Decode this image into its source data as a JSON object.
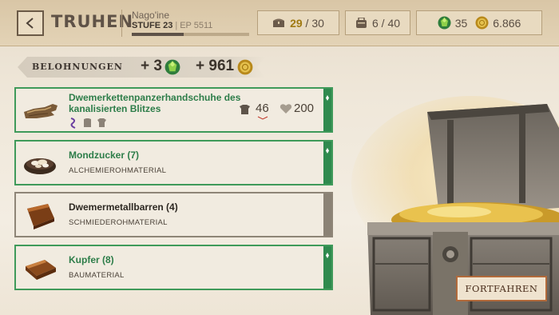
{
  "header": {
    "title": "TRUHEN",
    "player_name": "Nago'ine",
    "level_label": "STUFE 23",
    "ep_label": "EP 5511",
    "xp_progress": 0.44,
    "chests_current": "29",
    "chests_max": "/ 30",
    "inventory": "6 / 40",
    "gems": "35",
    "gold": "6.866"
  },
  "rewards": {
    "label": "BELOHNUNGEN",
    "gems": "+ 3",
    "gold": "+ 961"
  },
  "items": [
    {
      "name_line1": "Dwemerkettenpanzerhandschuhe des",
      "name_line2": "kanalisierten Blitzes",
      "armor": "46",
      "durability": "200"
    },
    {
      "name": "Mondzucker (7)",
      "category": "ALCHEMIEROHMATERIAL"
    },
    {
      "name": "Dwemermetallbarren (4)",
      "category": "SCHMIEDEROHMATERIAL"
    },
    {
      "name": "Kupfer (8)",
      "category": "BAUMATERIAL"
    }
  ],
  "actions": {
    "continue": "FORTFAHREN"
  },
  "icons": {
    "back": "chevron-left-icon",
    "chest": "chest-icon",
    "inventory": "backpack-icon",
    "gem": "gem-icon",
    "gold": "gold-coin-icon"
  },
  "colors": {
    "accent_green": "#3f9a5a",
    "gold": "#a07a12",
    "continue_border": "#b26a3b"
  }
}
